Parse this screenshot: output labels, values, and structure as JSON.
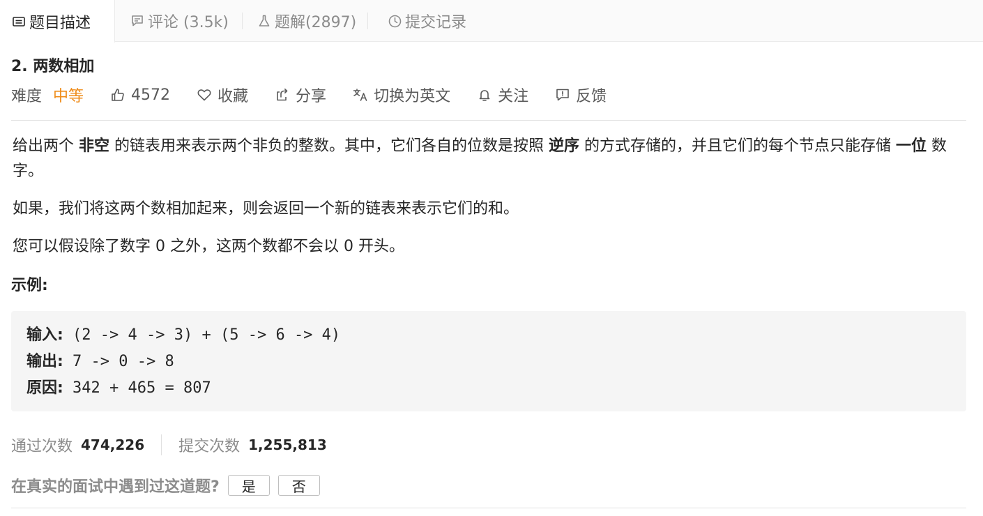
{
  "tabs": [
    {
      "label": "题目描述",
      "icon": "description-icon"
    },
    {
      "label": "评论 (3.5k)",
      "icon": "comment-icon"
    },
    {
      "label": "题解(2897)",
      "icon": "flask-icon"
    },
    {
      "label": "提交记录",
      "icon": "clock-icon"
    }
  ],
  "problem": {
    "title": "2. 两数相加",
    "difficulty_label": "难度",
    "difficulty_value": "中等",
    "likes": "4572",
    "favorite_label": "收藏",
    "share_label": "分享",
    "translate_label": "切换为英文",
    "follow_label": "关注",
    "feedback_label": "反馈"
  },
  "description": {
    "p1_a": "给出两个 ",
    "p1_b": "非空",
    "p1_c": " 的链表用来表示两个非负的整数。其中，它们各自的位数是按照 ",
    "p1_d": "逆序",
    "p1_e": " 的方式存储的，并且它们的每个节点只能存储 ",
    "p1_f": "一位",
    "p1_g": " 数字。",
    "p2": "如果，我们将这两个数相加起来，则会返回一个新的链表来表示它们的和。",
    "p3": "您可以假设除了数字 0 之外，这两个数都不会以 0 开头。"
  },
  "example": {
    "title": "示例:",
    "input_label": "输入:",
    "input_value": " (2 -> 4 -> 3) + (5 -> 6 -> 4)",
    "output_label": "输出:",
    "output_value": " 7 -> 0 -> 8",
    "reason_label": "原因:",
    "reason_value": " 342 + 465 = 807"
  },
  "stats": {
    "accepted_label": "通过次数",
    "accepted_value": "474,226",
    "submissions_label": "提交次数",
    "submissions_value": "1,255,813"
  },
  "interview": {
    "question": "在真实的面试中遇到过这道题?",
    "yes": "是",
    "no": "否"
  },
  "colors": {
    "difficulty_medium": "#ef8c1a",
    "text_primary": "#262626",
    "text_secondary": "#8c8c8c"
  }
}
